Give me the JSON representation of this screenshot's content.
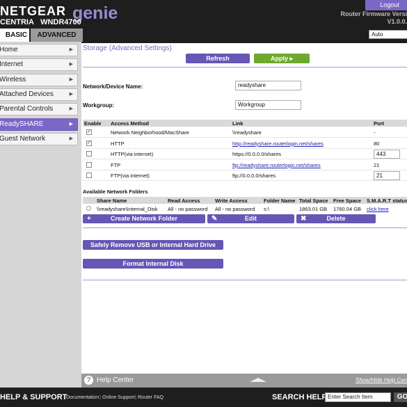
{
  "header": {
    "brand_netgear": "NETGEAR",
    "brand_genie": "genie",
    "model_prefix": "CENTRIA",
    "model": "WNDR4700",
    "logout": "Logout",
    "firmware_label": "Router Firmware Versi",
    "firmware_value": "V1.0.0.",
    "language": "Auto"
  },
  "tabs": {
    "basic": "BASIC",
    "advanced": "ADVANCED"
  },
  "sidebar": {
    "items": [
      {
        "label": "Home"
      },
      {
        "label": "Internet"
      },
      {
        "label": "Wireless"
      },
      {
        "label": "Attached Devices"
      },
      {
        "label": "Parental Controls"
      },
      {
        "label": "ReadySHARE"
      },
      {
        "label": "Guest Network"
      }
    ],
    "active_index": 5
  },
  "main": {
    "title": "Storage (Advanced Settings)",
    "refresh": "Refresh",
    "apply": "Apply",
    "device_name_label": "Network/Device Name:",
    "device_name_value": "readyshare",
    "workgroup_label": "Workgroup:",
    "workgroup_value": "Workgroup",
    "access_methods": {
      "headers": [
        "Enable",
        "Access Method",
        "Link",
        "Port"
      ],
      "rows": [
        {
          "checked": true,
          "method": "Network Neighborhood/MacShare",
          "link": "\\\\readyshare",
          "link_is_url": false,
          "port": "-",
          "port_editable": false
        },
        {
          "checked": true,
          "method": "HTTP",
          "link": "http://readyshare.routerlogin.net/shares",
          "link_is_url": true,
          "port": "80",
          "port_editable": false
        },
        {
          "checked": false,
          "method": "HTTP(via internet)",
          "link": "https://0.0.0.0/shares",
          "link_is_url": false,
          "port": "443",
          "port_editable": true
        },
        {
          "checked": false,
          "method": "FTP",
          "link": "ftp://readyshare.routerlogin.net/shares",
          "link_is_url": true,
          "port": "21",
          "port_editable": false
        },
        {
          "checked": false,
          "method": "FTP(via internet)",
          "link": "ftp://0.0.0.0/shares",
          "link_is_url": false,
          "port": "21",
          "port_editable": true
        }
      ]
    },
    "folders": {
      "title": "Available Network Folders",
      "headers": [
        "Share Name",
        "Read Access",
        "Write Access",
        "Folder Name",
        "Total Space",
        "Free Space",
        "S.M.A.R.T status"
      ],
      "rows": [
        {
          "share_name": "\\\\readyshare\\Internal_Disk",
          "read": "All - no password",
          "write": "All - no password",
          "folder": "s:\\",
          "total": "1863.01 GB",
          "free": "1760.04 GB",
          "smart": "click here"
        }
      ]
    },
    "create_folder": "Create Network Folder",
    "edit": "Edit",
    "delete": "Delete",
    "safely_remove": "Safely Remove USB or Internal Hard Drive",
    "format": "Format Internal Disk"
  },
  "helpbar": {
    "title": "Help Center",
    "toggle": "Show/Hide Help Cent"
  },
  "footer": {
    "help_support": "HELP & SUPPORT",
    "links": [
      "Documentation",
      "Online Support",
      "Router FAQ"
    ],
    "search_label": "SEARCH HELP",
    "search_placeholder": "Enter Search Item",
    "go": "GO"
  },
  "colors": {
    "accent": "#7b68c6",
    "button": "#6756b5",
    "apply_green": "#6ea82c",
    "dark": "#1e1e1e"
  }
}
